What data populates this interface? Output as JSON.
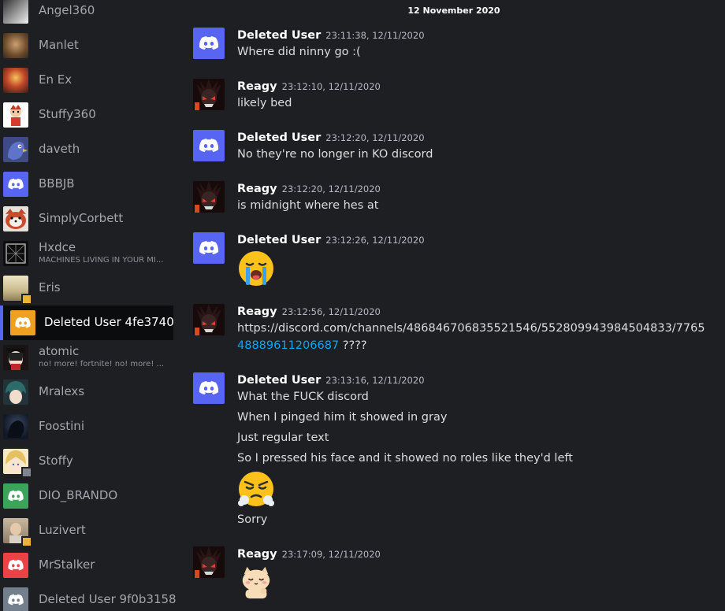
{
  "members": [
    {
      "name": "Angel360",
      "status": "",
      "avatar": "photo-gray"
    },
    {
      "name": "Manlet",
      "status": "",
      "avatar": "photo-brown"
    },
    {
      "name": "En Ex",
      "status": "",
      "avatar": "photo-red"
    },
    {
      "name": "Stuffy360",
      "status": "",
      "avatar": "cartoon-white"
    },
    {
      "name": "daveth",
      "status": "",
      "avatar": "bird-blue"
    },
    {
      "name": "BBBJB",
      "status": "",
      "avatar": "discord-blurple"
    },
    {
      "name": "SimplyCorbett",
      "status": "",
      "avatar": "red-panda"
    },
    {
      "name": "Hxdce",
      "status": "MACHINES LIVING IN YOUR MI...",
      "avatar": "wireframe-black"
    },
    {
      "name": "Eris",
      "status": "",
      "avatar": "anime-light"
    },
    {
      "name": "Deleted User 4fe3740",
      "status": "",
      "avatar": "discord-yellow",
      "selected": true
    },
    {
      "name": "atomic",
      "status": "no! more! fortnite! no! more! ...",
      "avatar": "anime-dark"
    },
    {
      "name": "Mralexs",
      "status": "",
      "avatar": "anime-teal"
    },
    {
      "name": "Foostini",
      "status": "",
      "avatar": "anime-night"
    },
    {
      "name": "Stoffy",
      "status": "",
      "avatar": "anime-blonde"
    },
    {
      "name": "DIO_BRANDO",
      "status": "",
      "avatar": "discord-green"
    },
    {
      "name": "Luzivert",
      "status": "",
      "avatar": "photo-beige"
    },
    {
      "name": "MrStalker",
      "status": "",
      "avatar": "discord-red"
    },
    {
      "name": "Deleted User 9f0b3158",
      "status": "",
      "avatar": "discord-gray"
    }
  ],
  "chat": {
    "date_divider": "12 November 2020",
    "messages": [
      {
        "author": "Deleted User",
        "time": "23:11:38, 12/11/2020",
        "avatar": "discord-blurple",
        "lines": [
          "Where did ninny go :("
        ]
      },
      {
        "author": "Reagy",
        "time": "23:12:10, 12/11/2020",
        "avatar": "reagy",
        "lines": [
          "likely bed"
        ]
      },
      {
        "author": "Deleted User",
        "time": "23:12:20, 12/11/2020",
        "avatar": "discord-blurple",
        "lines": [
          "No they're no longer in KO discord"
        ]
      },
      {
        "author": "Reagy",
        "time": "23:12:20, 12/11/2020",
        "avatar": "reagy",
        "lines": [
          "is midnight where hes at"
        ]
      },
      {
        "author": "Deleted User",
        "time": "23:12:26, 12/11/2020",
        "avatar": "discord-blurple",
        "emoji": "sob-emoji"
      },
      {
        "author": "Reagy",
        "time": "23:12:56, 12/11/2020",
        "avatar": "reagy",
        "link_line1": "https://discord.com/channels/486846706835521546/552809943984504833/7765",
        "link_line2": "48889611206687",
        "link_suffix": " ????"
      },
      {
        "author": "Deleted User",
        "time": "23:13:16, 12/11/2020",
        "avatar": "discord-blurple",
        "lines": [
          "What the FUCK discord",
          "When I pinged him it showed in gray",
          "Just regular text",
          "So I pressed his face and it showed no roles like they'd left"
        ],
        "emoji": "triumph-emoji",
        "after_emoji": "Sorry"
      },
      {
        "author": "Reagy",
        "time": "23:17:09, 12/11/2020",
        "avatar": "reagy",
        "emoji": "cat-sticker"
      }
    ]
  },
  "colors": {
    "background": "#1e1f22",
    "blurple": "#5865f2",
    "link": "#00a8fc",
    "idle": "#f0b232"
  }
}
